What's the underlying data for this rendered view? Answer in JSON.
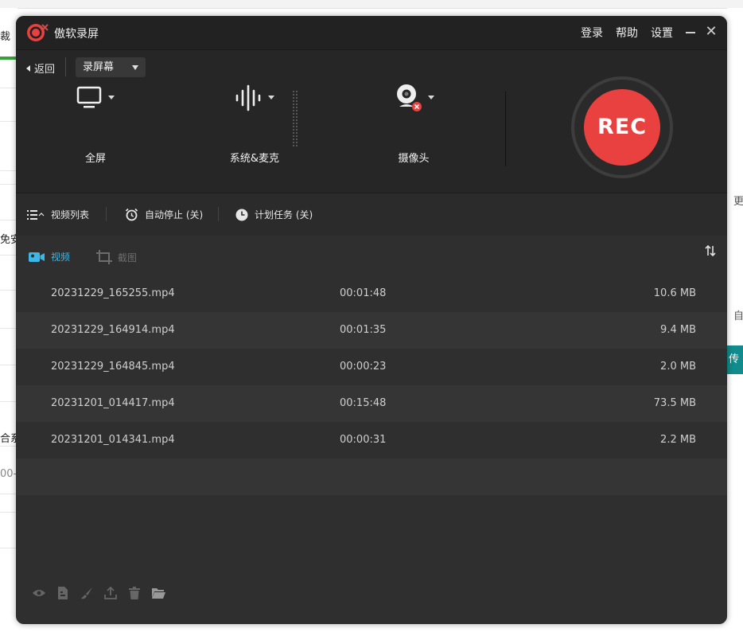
{
  "app": {
    "title": "傲软录屏",
    "accent_color": "#e8413f",
    "header_buttons": {
      "login": "登录",
      "help": "帮助",
      "settings": "设置"
    }
  },
  "controls": {
    "back_label": "返回",
    "mode": "录屏幕",
    "sources": [
      {
        "label": "全屏",
        "icon": "monitor-icon"
      },
      {
        "label": "系统&麦克",
        "icon": "audio-wave-icon"
      },
      {
        "label": "摄像头",
        "icon": "webcam-icon"
      }
    ],
    "rec_label": "REC"
  },
  "options": {
    "video_list": "视频列表",
    "auto_stop": "自动停止 (关)",
    "schedule": "计划任务 (关)"
  },
  "tabs": {
    "video": "视频",
    "screenshot": "截图",
    "active_color": "#3ab8e8"
  },
  "recordings": [
    {
      "name": "20231229_165255.mp4",
      "duration": "00:01:48",
      "size": "10.6 MB"
    },
    {
      "name": "20231229_164914.mp4",
      "duration": "00:01:35",
      "size": "9.4 MB"
    },
    {
      "name": "20231229_164845.mp4",
      "duration": "00:00:23",
      "size": "2.0 MB"
    },
    {
      "name": "20231201_014417.mp4",
      "duration": "00:15:48",
      "size": "73.5 MB"
    },
    {
      "name": "20231201_014341.mp4",
      "duration": "00:00:31",
      "size": "2.2 MB"
    }
  ],
  "footer_tools": [
    "eye-icon",
    "file-icon",
    "brush-icon",
    "upload-icon",
    "trash-icon",
    "folder-icon"
  ],
  "background": {
    "left_fragments": [
      "裁",
      "免安",
      "合系",
      "00-"
    ],
    "right_fragments": [
      "更",
      "自",
      "传"
    ]
  }
}
